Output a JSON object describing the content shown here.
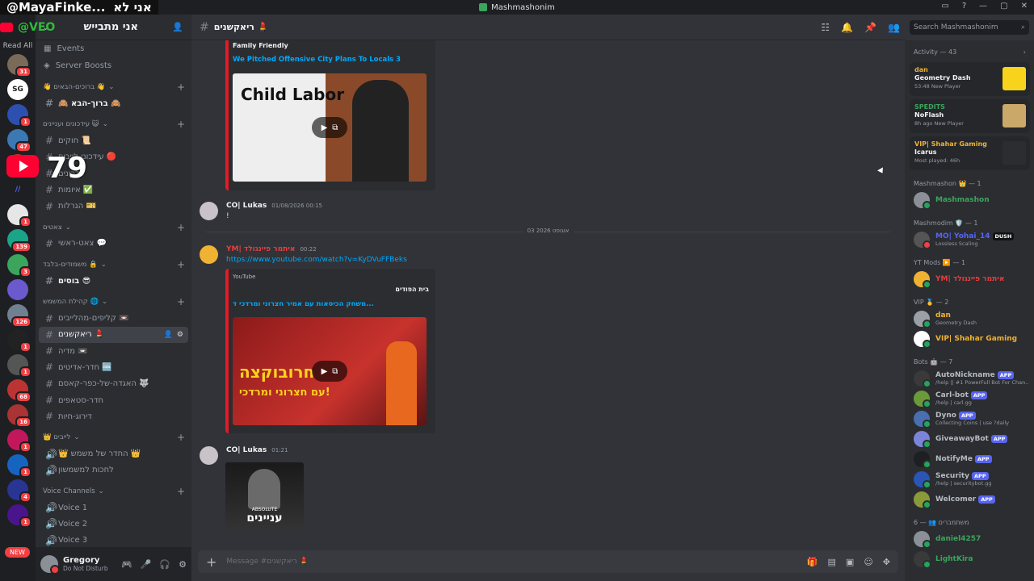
{
  "overlay": {
    "handle": "@MayaFinke...",
    "hebrew": "אני לא",
    "handle2": "@VEO"
  },
  "window": {
    "title": "Mashmashonim",
    "controls": [
      "▭",
      "?",
      "—",
      "▢",
      "✕"
    ]
  },
  "serverbar": {
    "read_all": "Read All",
    "badges": [
      "31",
      "1",
      "47",
      "1",
      "139",
      "3",
      "126",
      "1",
      "1",
      "68",
      "16",
      "1",
      "1",
      "4",
      "1"
    ],
    "youtube_count": "79",
    "new_label": "NEW"
  },
  "guild": {
    "name": "אני מתבייש",
    "search_placeholder": "Search Mashmashonim"
  },
  "nav": [
    {
      "label": "Events",
      "icon": "calendar-icon"
    },
    {
      "label": "Server Boosts",
      "icon": "boost-icon"
    }
  ],
  "categories": [
    {
      "name": "👋 ברוכים-הבאים 👋",
      "channels": [
        {
          "name": "🙈 ברוך-הבא 🙈",
          "bold": true
        }
      ]
    },
    {
      "name": "עידכונים ועניינים 😺",
      "channels": [
        {
          "name": "חוקים 📜"
        },
        {
          "name": "עידכוני-לייבים 🔴"
        },
        {
          "name": "עדכונים"
        },
        {
          "name": "איומות ✅"
        },
        {
          "name": "הגרלות 🎫"
        }
      ]
    },
    {
      "name": "צאטים",
      "channels": [
        {
          "name": "צאט-ראשי 💬"
        }
      ]
    },
    {
      "name": "משמודים-בלבד 🔒",
      "channels": [
        {
          "name": "בוסים 😎",
          "bold": true
        }
      ]
    },
    {
      "name": "קהילת המשמש 🌐",
      "channels": [
        {
          "name": "קליפים-מהלייבים 📼"
        },
        {
          "name": "ריאקשנים 💄",
          "active": true
        },
        {
          "name": "מדיה 📼"
        },
        {
          "name": "חדר-אדיטים 🆒"
        },
        {
          "name": "האגדה-של-כפר-קאסם 🐺"
        },
        {
          "name": "חדר-סטאפים"
        },
        {
          "name": "דירוג-חיות"
        }
      ]
    },
    {
      "name": "👑 לייבים",
      "channels": [
        {
          "name": "👑 החדר של משמש 👑",
          "voice": true
        },
        {
          "name": "לחכות למשמשון",
          "voice": true
        }
      ]
    },
    {
      "name": "Voice Channels",
      "channels": [
        {
          "name": "Voice 1",
          "voice": true
        },
        {
          "name": "Voice 2",
          "voice": true
        },
        {
          "name": "Voice 3",
          "voice": true
        }
      ]
    }
  ],
  "user": {
    "name": "Gregory",
    "status": "Do Not Disturb"
  },
  "chat": {
    "channel": "ריאקשנים 💄",
    "embed1": {
      "author": "Family Friendly",
      "title": "We Pitched Offensive City Plans To Locals 3",
      "thumb_text": "Child Labor"
    },
    "msg1": {
      "author": "CO| Lukas",
      "time": "01/08/2026 00:15",
      "text": "!"
    },
    "date_divider": "03 אוגוסט 2026",
    "msg2": {
      "author": "YM| איתמר פיינגולד",
      "time": "00:22",
      "link": "https://www.youtube.com/watch?v=KyDVuFFBeks"
    },
    "embed2": {
      "provider": "YouTube",
      "author": "בית הפודים",
      "title": "משחק הכיסאות עם אמיר חצרוני ומרדכי ד...",
      "thumb_text": "חרובוקצה",
      "thumb_text2": "עם חצרוני ומרדכי!"
    },
    "msg3": {
      "author": "CO| Lukas",
      "time": "01:21",
      "img_text1": "ABSOLUTE",
      "img_text2": "עניינים"
    },
    "composer_placeholder": "Message #ריאקשנים 💄"
  },
  "members": {
    "activity_label": "Activity — 43",
    "activities": [
      {
        "name": "dan",
        "game": "Geometry Dash",
        "time": "53:48",
        "tag": "New Player",
        "color": "#f0b232"
      },
      {
        "name": "SPEDITS",
        "game": "NoFlash",
        "time": "8h ago",
        "tag": "New Player",
        "color": "#3ba55c"
      },
      {
        "name": "VIP| Shahar Gaming",
        "game": "Icarus",
        "time": "Most played: 46h",
        "tag": "",
        "color": "#f0b232"
      }
    ],
    "groups": [
      {
        "label": "Mashmashon 👑 — 1",
        "members": [
          {
            "name": "Mashmashon",
            "sub": "",
            "color": "#3ba55c"
          }
        ]
      },
      {
        "label": "Mashmodim 🛡️ — 1",
        "members": [
          {
            "name": "MO| Yohai_14",
            "sub": "Lossless Scaling",
            "color": "#5865f2",
            "tag": "DUSH"
          }
        ]
      },
      {
        "label": "YT Mods ▶️ — 1",
        "members": [
          {
            "name": "YM| איתמר פיינגולד",
            "sub": "",
            "color": "#e3403f"
          }
        ]
      },
      {
        "label": "VIP 🥇 — 2",
        "members": [
          {
            "name": "dan",
            "sub": "Geometry Dash",
            "color": "#f0b232"
          },
          {
            "name": "VIP| Shahar Gaming",
            "sub": "",
            "color": "#f0b232"
          }
        ]
      },
      {
        "label": "Bots 🤖 — 7",
        "members": [
          {
            "name": "AutoNickname",
            "sub": "/help || #1 PowerFull Bot For Chan...",
            "color": "#b5bac1",
            "tag": "APP"
          },
          {
            "name": "Carl-bot",
            "sub": "/help | carl.gg",
            "color": "#b5bac1",
            "tag": "APP"
          },
          {
            "name": "Dyno",
            "sub": "Collecting Coins | use ?daily",
            "color": "#b5bac1",
            "tag": "APP"
          },
          {
            "name": "GiveawayBot",
            "sub": "",
            "color": "#b5bac1",
            "tag": "APP"
          },
          {
            "name": "NotifyMe",
            "sub": "",
            "color": "#b5bac1",
            "tag": "APP"
          },
          {
            "name": "Security",
            "sub": "/help | securitybot.gg",
            "color": "#b5bac1",
            "tag": "APP"
          },
          {
            "name": "Welcomer",
            "sub": "",
            "color": "#b5bac1",
            "tag": "APP"
          }
        ]
      },
      {
        "label": "משתמברים 👥 — 6",
        "members": [
          {
            "name": "daniel4257",
            "sub": "",
            "color": "#3ba55c"
          },
          {
            "name": "LightKira",
            "sub": "",
            "color": "#3ba55c"
          }
        ]
      }
    ]
  }
}
